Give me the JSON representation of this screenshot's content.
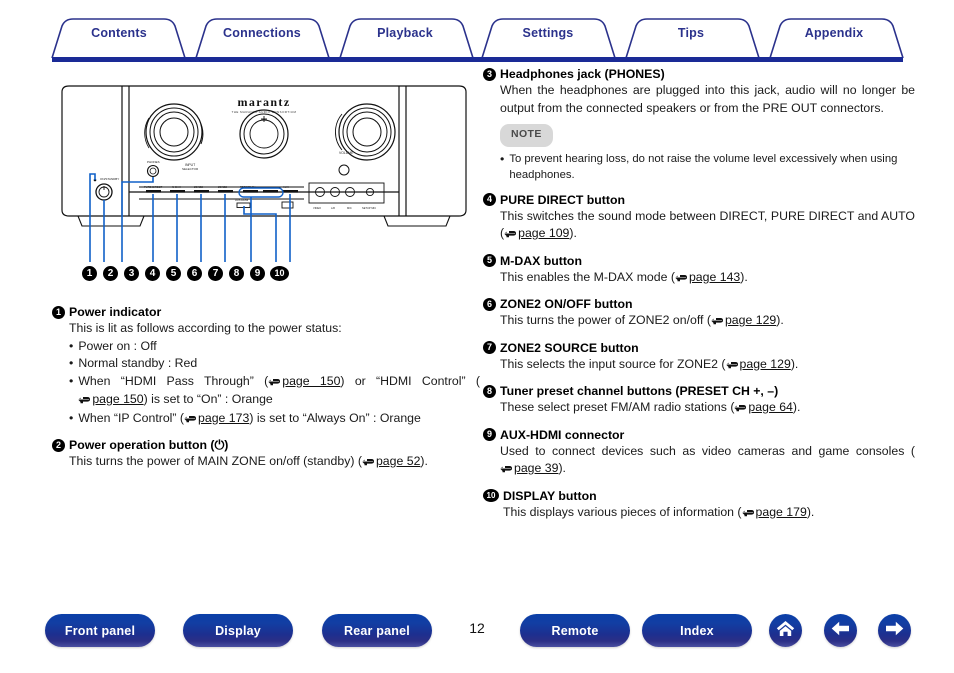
{
  "tabs": [
    {
      "label": "Contents"
    },
    {
      "label": "Connections"
    },
    {
      "label": "Playback"
    },
    {
      "label": "Settings"
    },
    {
      "label": "Tips"
    },
    {
      "label": "Appendix"
    }
  ],
  "colors": {
    "tab_text": "#2b328c",
    "tab_outline": "#2b328c",
    "rule": "#1a2a96",
    "button_blue": "#123ea3",
    "note_pill_bg": "#d8d8d8",
    "callout_black": "#000000"
  },
  "diagram": {
    "name": "marantz-av-receiver-front-panel",
    "brand": "marantz",
    "brand_sub": "THE MARANTZ AUDIO CONSORTIUM",
    "callout_numbers": [
      "1",
      "2",
      "3",
      "4",
      "5",
      "6",
      "7",
      "8",
      "9",
      "10"
    ]
  },
  "left_column": {
    "items": [
      {
        "num": "1",
        "title": "Power indicator",
        "intro": "This is lit as follows according to the power status:",
        "bullets": [
          {
            "text": "Power on : Off"
          },
          {
            "text": "Normal standby : Red"
          },
          {
            "pre": "When “HDMI Pass Through” (",
            "ref1": "page 150",
            "mid": ") or “HDMI Control” (",
            "ref2": "page 150",
            "post": ") is set to “On” : Orange"
          },
          {
            "pre": "When “IP Control” (",
            "ref1": "page 173",
            "post": ") is set to “Always On” : Orange"
          }
        ]
      },
      {
        "num": "2",
        "title": "Power operation button (⏻)",
        "body_pre": "This turns the power of MAIN ZONE on/off (standby) (",
        "body_ref": "page 52",
        "body_post": ")."
      }
    ]
  },
  "right_column": {
    "items": [
      {
        "num": "3",
        "title": "Headphones jack (PHONES)",
        "body": "When the headphones are plugged into this jack, audio will no longer be output from the connected speakers or from the PRE OUT connectors.",
        "note_label": "NOTE",
        "note_bullet": "To prevent hearing loss, do not raise the volume level excessively when using headphones."
      },
      {
        "num": "4",
        "title": "PURE DIRECT button",
        "body_pre": "This switches the sound mode between DIRECT, PURE DIRECT and AUTO (",
        "body_ref": "page 109",
        "body_post": ")."
      },
      {
        "num": "5",
        "title": "M-DAX button",
        "body_pre": "This enables the M-DAX mode (",
        "body_ref": "page 143",
        "body_post": ")."
      },
      {
        "num": "6",
        "title": "ZONE2 ON/OFF button",
        "body_pre": "This turns the power of ZONE2 on/off (",
        "body_ref": "page 129",
        "body_post": ")."
      },
      {
        "num": "7",
        "title": "ZONE2 SOURCE button",
        "body_pre": "This selects the input source for ZONE2 (",
        "body_ref": "page 129",
        "body_post": ")."
      },
      {
        "num": "8",
        "title": "Tuner preset channel buttons (PRESET CH +, –)",
        "body_pre": "These select preset FM/AM radio stations (",
        "body_ref": "page 64",
        "body_post": ")."
      },
      {
        "num": "9",
        "title": "AUX-HDMI connector",
        "body_pre": "Used to connect devices such as video cameras and game consoles (",
        "body_ref": "page 39",
        "body_post": ")."
      },
      {
        "num": "10",
        "title": "DISPLAY button",
        "body_pre": "This displays various pieces of information (",
        "body_ref": "page 179",
        "body_post": ")."
      }
    ]
  },
  "footer": {
    "buttons": [
      {
        "label": "Front panel"
      },
      {
        "label": "Display"
      },
      {
        "label": "Rear panel"
      },
      {
        "label": "Remote"
      },
      {
        "label": "Index"
      }
    ],
    "icons": [
      {
        "name": "home-icon"
      },
      {
        "name": "arrow-left-icon"
      },
      {
        "name": "arrow-right-icon"
      }
    ],
    "page_number": "12"
  }
}
